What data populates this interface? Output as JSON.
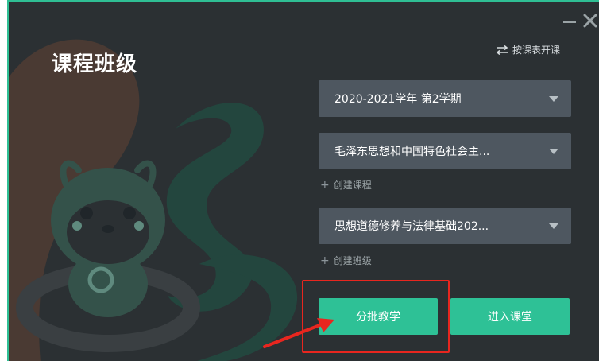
{
  "window": {
    "title": "课程班级",
    "border_color": "#2fbf94",
    "background_color": "#2b3033"
  },
  "switch_link": {
    "label": "按课表开课",
    "icon": "swap-arrows-icon"
  },
  "selects": {
    "term": {
      "value": "2020-2021学年 第2学期"
    },
    "course": {
      "value": "毛泽东思想和中国特色社会主..."
    },
    "class": {
      "value": "思想道德修养与法律基础202..."
    }
  },
  "add_course": {
    "icon": "plus-icon",
    "label": "创建课程"
  },
  "add_class": {
    "icon": "plus-icon",
    "label": "创建班级"
  },
  "buttons": {
    "batch_teaching": "分批教学",
    "enter_classroom": "进入课堂",
    "color": "#2ec196"
  },
  "annotation": {
    "color": "#e8261f",
    "shape": "red-box-with-arrow"
  }
}
